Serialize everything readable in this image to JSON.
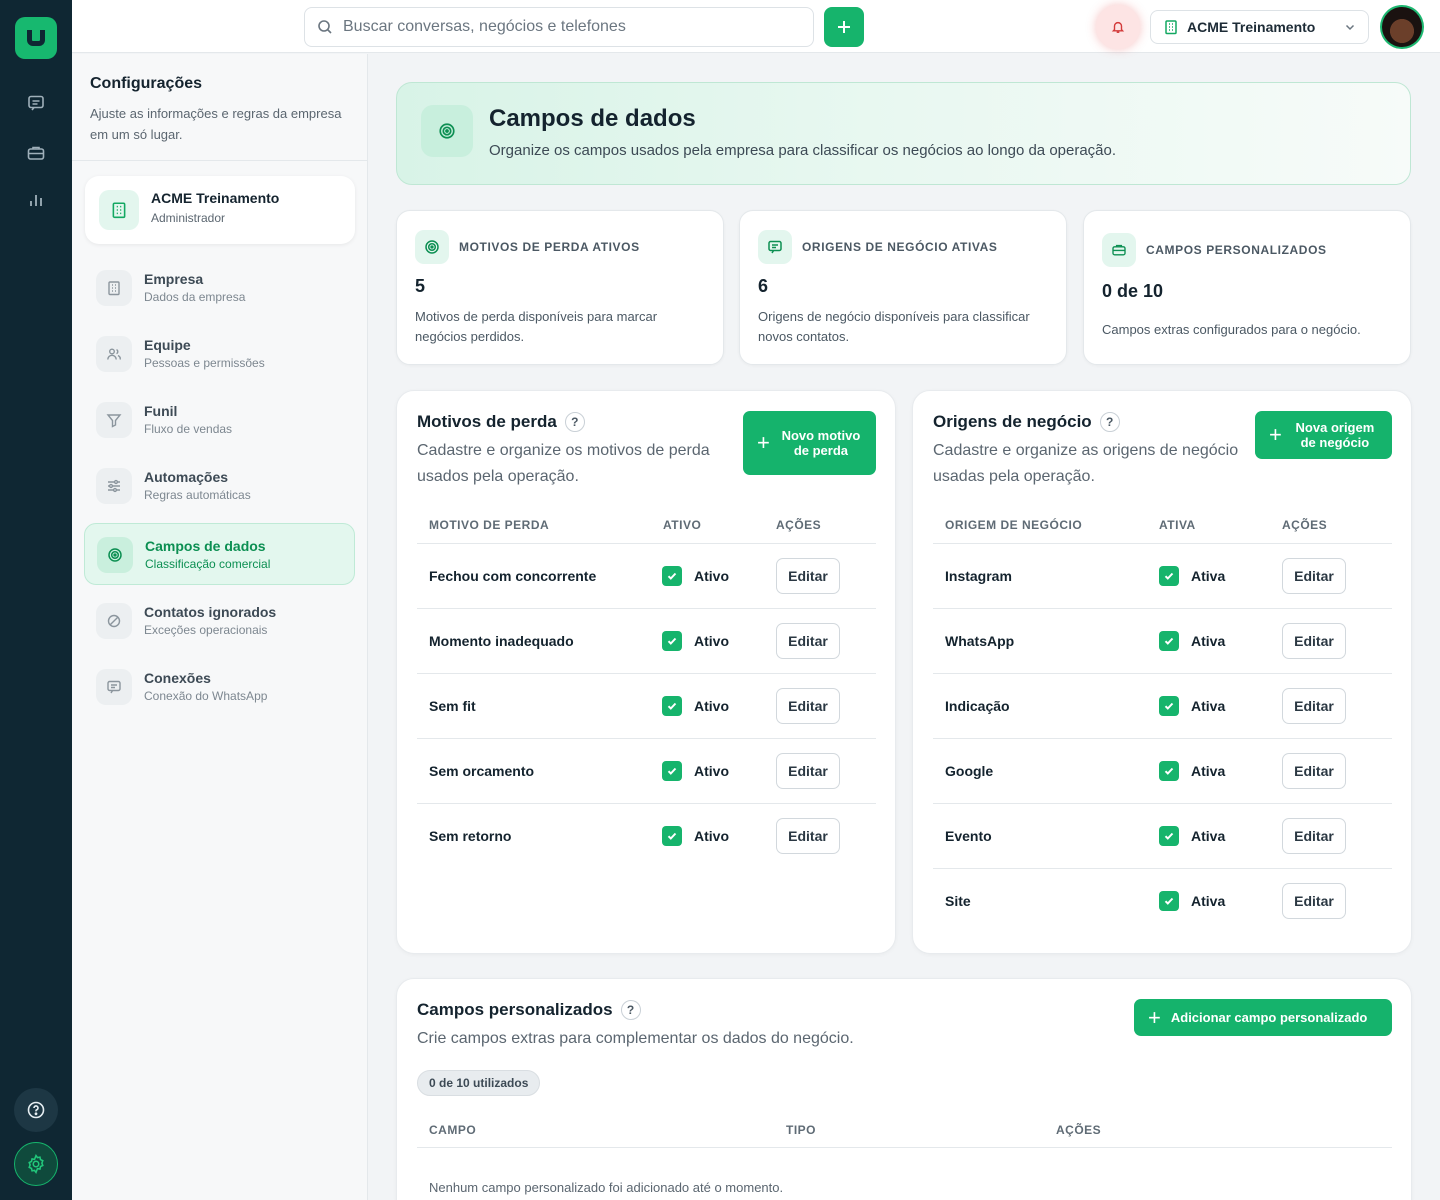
{
  "rail": {
    "icons": [
      "chat-icon",
      "briefcase-icon",
      "bar-chart-icon"
    ],
    "bottom": [
      "help-icon",
      "settings-icon"
    ]
  },
  "topbar": {
    "search_placeholder": "Buscar conversas, negócios e telefones",
    "company": "ACME Treinamento"
  },
  "sidebar": {
    "title": "Configurações",
    "description": "Ajuste as informações e regras da empresa em um só lugar.",
    "org": {
      "name": "ACME Treinamento",
      "role": "Administrador"
    },
    "items": [
      {
        "label": "Empresa",
        "sub": "Dados da empresa",
        "icon": "building-icon"
      },
      {
        "label": "Equipe",
        "sub": "Pessoas e permissões",
        "icon": "users-icon"
      },
      {
        "label": "Funil",
        "sub": "Fluxo de vendas",
        "icon": "filter-icon"
      },
      {
        "label": "Automações",
        "sub": "Regras automáticas",
        "icon": "sliders-icon"
      },
      {
        "label": "Campos de dados",
        "sub": "Classificação comercial",
        "icon": "target-icon",
        "active": true
      },
      {
        "label": "Contatos ignorados",
        "sub": "Exceções operacionais",
        "icon": "ban-icon"
      },
      {
        "label": "Conexões",
        "sub": "Conexão do WhatsApp",
        "icon": "message-icon"
      }
    ]
  },
  "hero": {
    "title": "Campos de dados",
    "description": "Organize os campos usados pela empresa para classificar os negócios ao longo da operação."
  },
  "stats": [
    {
      "label": "MOTIVOS DE PERDA ATIVOS",
      "value": "5",
      "text": "Motivos de perda disponíveis para marcar negócios perdidos."
    },
    {
      "label": "ORIGENS DE NEGÓCIO ATIVAS",
      "value": "6",
      "text": "Origens de negócio disponíveis para classificar novos contatos."
    },
    {
      "label": "CAMPOS PERSONALIZADOS",
      "value": "0 de 10",
      "text": "Campos extras configurados para o negócio."
    }
  ],
  "loss": {
    "title": "Motivos de perda",
    "help": "?",
    "description": "Cadastre e organize os motivos de perda usados pela operação.",
    "button": "Novo motivo de perda",
    "columns": [
      "MOTIVO DE PERDA",
      "ATIVO",
      "AÇÕES"
    ],
    "rows": [
      {
        "name": "Fechou com concorrente",
        "status": "Ativo",
        "action": "Editar"
      },
      {
        "name": "Momento inadequado",
        "status": "Ativo",
        "action": "Editar"
      },
      {
        "name": "Sem fit",
        "status": "Ativo",
        "action": "Editar"
      },
      {
        "name": "Sem orcamento",
        "status": "Ativo",
        "action": "Editar"
      },
      {
        "name": "Sem retorno",
        "status": "Ativo",
        "action": "Editar"
      }
    ]
  },
  "origins": {
    "title": "Origens de negócio",
    "help": "?",
    "description": "Cadastre e organize as origens de negócio usadas pela operação.",
    "button": "Nova origem de negócio",
    "columns": [
      "ORIGEM DE NEGÓCIO",
      "ATIVA",
      "AÇÕES"
    ],
    "rows": [
      {
        "name": "Instagram",
        "status": "Ativa",
        "action": "Editar"
      },
      {
        "name": "WhatsApp",
        "status": "Ativa",
        "action": "Editar"
      },
      {
        "name": "Indicação",
        "status": "Ativa",
        "action": "Editar"
      },
      {
        "name": "Google",
        "status": "Ativa",
        "action": "Editar"
      },
      {
        "name": "Evento",
        "status": "Ativa",
        "action": "Editar"
      },
      {
        "name": "Site",
        "status": "Ativa",
        "action": "Editar"
      }
    ]
  },
  "custom": {
    "title": "Campos personalizados",
    "help": "?",
    "description": "Crie campos extras para complementar os dados do negócio.",
    "button": "Adicionar campo personalizado",
    "badge": "0 de 10 utilizados",
    "columns": [
      "CAMPO",
      "TIPO",
      "AÇÕES"
    ],
    "empty": "Nenhum campo personalizado foi adicionado até o momento."
  },
  "colors": {
    "accent": "#16b46c",
    "rail": "#0f2733",
    "active_bg": "#e3f7ee"
  }
}
